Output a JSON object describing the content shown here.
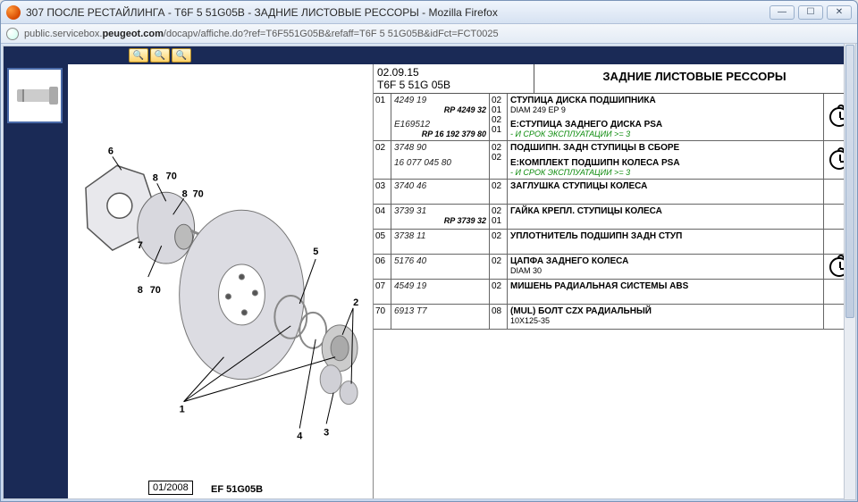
{
  "window": {
    "title": "307 ПОСЛЕ РЕСТАЙЛИНГА - T6F 5 51G05B - ЗАДНИЕ ЛИСТОВЫЕ РЕССОРЫ - Mozilla Firefox",
    "url_prefix": "public.servicebox.",
    "url_bold": "peugeot.com",
    "url_suffix": "/docapv/affiche.do?ref=T6F551G05B&refaff=T6F 5 51G05B&idFct=FCT0025"
  },
  "toolbar": {
    "zoom_in": "🔍+",
    "zoom_out": "🔍−",
    "zoom_fit": "🔍↔"
  },
  "header": {
    "date": "02.09.15",
    "code": "T6F 5 51G 05B",
    "title": "ЗАДНИЕ ЛИСТОВЫЕ РЕССОРЫ"
  },
  "diagram": {
    "callouts": [
      "1",
      "2",
      "3",
      "4",
      "5",
      "6",
      "7",
      "8",
      "8",
      "8",
      "70",
      "70",
      "70"
    ],
    "footer_date": "01/2008",
    "footer_code": "EF 51G05B"
  },
  "parts": [
    {
      "num": "01",
      "entries": [
        {
          "pn": "4249 19",
          "rp": "RP 4249 32",
          "qty": "02\n01",
          "desc": "СТУПИЦА ДИСКА ПОДШИПНИКА",
          "sub": "DIAM 249 EP 9"
        },
        {
          "pn": "E169512",
          "rp": "RP 16 192 379 80",
          "qty": "02\n01",
          "desc": "E:СТУПИЦА ЗАДНЕГО ДИСКА PSA",
          "green": "- И СРОК ЭКСПЛУАТАЦИИ >= 3"
        }
      ],
      "clock": true
    },
    {
      "num": "02",
      "entries": [
        {
          "pn": "3748 90",
          "qty": "02",
          "desc": "ПОДШИПН. ЗАДН СТУПИЦЫ В СБОРЕ"
        },
        {
          "pn": "16 077 045 80",
          "qty": "02",
          "desc": "E:КОМПЛЕКТ ПОДШИПН КОЛЕСА PSA",
          "green": "- И СРОК ЭКСПЛУАТАЦИИ >= 3"
        }
      ],
      "clock": true
    },
    {
      "num": "03",
      "entries": [
        {
          "pn": "3740 46",
          "qty": "02",
          "desc": "ЗАГЛУШКА СТУПИЦЫ КОЛЕСА"
        }
      ]
    },
    {
      "num": "04",
      "entries": [
        {
          "pn": "3739 31",
          "rp": "RP 3739 32",
          "qty": "02\n01",
          "desc": "ГАЙКА КРЕПЛ. СТУПИЦЫ КОЛЕСА"
        }
      ]
    },
    {
      "num": "05",
      "entries": [
        {
          "pn": "3738 11",
          "qty": "02",
          "desc": "УПЛОТНИТЕЛЬ ПОДШИПН ЗАДН СТУП"
        }
      ]
    },
    {
      "num": "06",
      "entries": [
        {
          "pn": "5176 40",
          "qty": "02",
          "desc": "ЦАПФА ЗАДНЕГО КОЛЕСА",
          "sub": "DIAM 30"
        }
      ],
      "clock": true
    },
    {
      "num": "07",
      "entries": [
        {
          "pn": "4549 19",
          "qty": "02",
          "desc": "МИШЕНЬ РАДИАЛЬНАЯ СИСТЕМЫ ABS"
        }
      ]
    },
    {
      "num": "70",
      "entries": [
        {
          "pn": "6913 T7",
          "qty": "08",
          "desc": "(MUL) БОЛТ CZX РАДИАЛЬНЫЙ",
          "sub": "10X125-35"
        }
      ]
    }
  ]
}
